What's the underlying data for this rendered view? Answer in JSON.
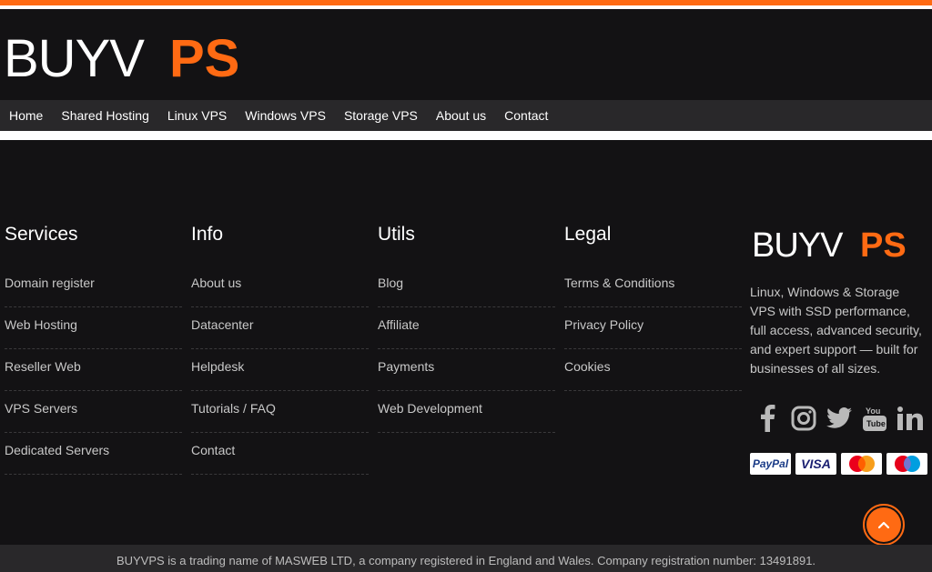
{
  "brand": {
    "part1": "BUYV",
    "part2": "PS"
  },
  "nav": {
    "items": [
      {
        "label": "Home"
      },
      {
        "label": "Shared Hosting"
      },
      {
        "label": "Linux VPS"
      },
      {
        "label": "Windows VPS"
      },
      {
        "label": "Storage VPS"
      },
      {
        "label": "About us"
      },
      {
        "label": "Contact"
      }
    ]
  },
  "footer": {
    "services": {
      "title": "Services",
      "items": [
        "Domain register",
        "Web Hosting",
        "Reseller Web",
        "VPS Servers",
        "Dedicated Servers"
      ]
    },
    "info": {
      "title": "Info",
      "items": [
        "About us",
        "Datacenter",
        "Helpdesk",
        "Tutorials / FAQ",
        "Contact"
      ]
    },
    "utils": {
      "title": "Utils",
      "items": [
        "Blog",
        "Affiliate",
        "Payments",
        "Web Development"
      ]
    },
    "legal": {
      "title": "Legal",
      "items": [
        "Terms & Conditions",
        "Privacy Policy",
        "Cookies"
      ]
    },
    "description": "Linux, Windows & Storage VPS with SSD performance, full access, advanced security, and expert support — built for businesses of all sizes.",
    "socials": [
      "facebook-icon",
      "instagram-icon",
      "twitter-icon",
      "youtube-icon",
      "linkedin-icon"
    ],
    "payments": [
      {
        "label": "PayPal"
      },
      {
        "label": "VISA"
      },
      {
        "label": "mastercard-icon"
      },
      {
        "label": "maestro-icon"
      }
    ]
  },
  "copyright": "BUYVPS is a trading name of MASWEB LTD, a company registered in England and Wales. Company registration number: 13491891.",
  "colors": {
    "accent": "#ff6a13",
    "background": "#131214",
    "nav": "#29282a"
  }
}
